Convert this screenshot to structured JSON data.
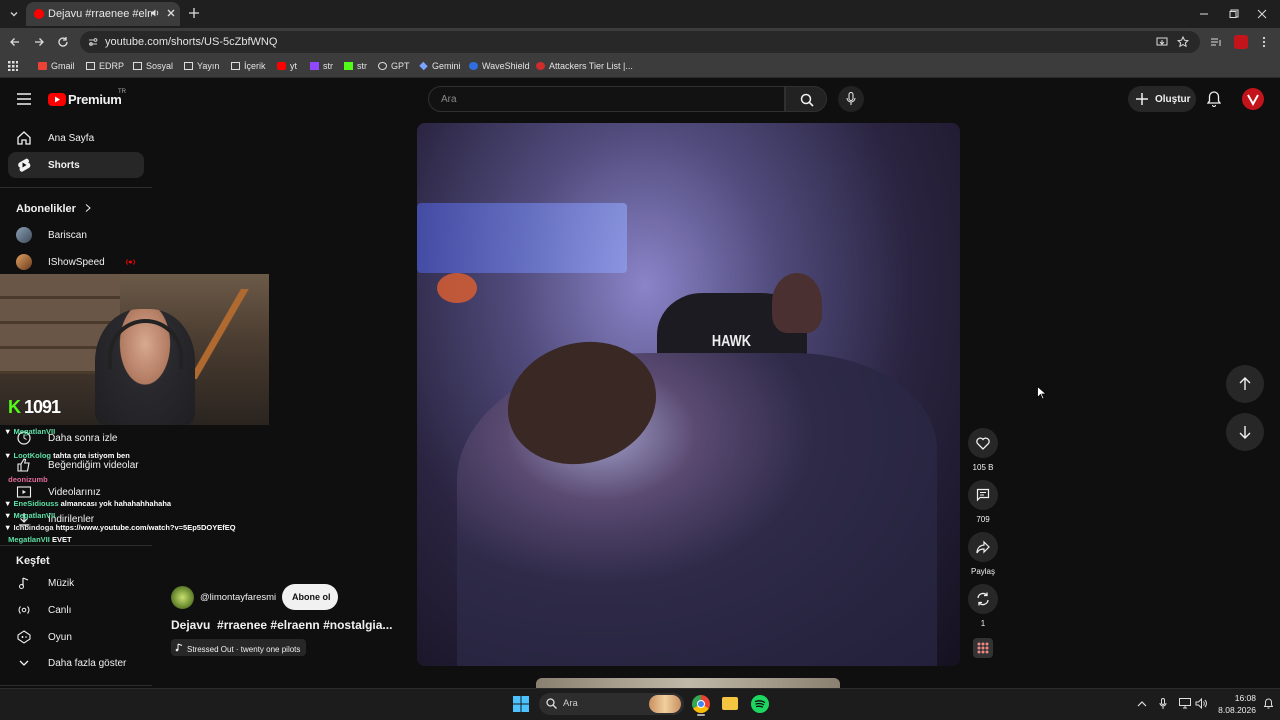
{
  "browser": {
    "tab_title": "Dejavu #rraenee #elraenn #",
    "url": "youtube.com/shorts/US-5cZbfWNQ",
    "bookmarks": [
      "Gmail",
      "EDRP",
      "Sosyal",
      "Yayın",
      "İçerik",
      "yt",
      "str",
      "str",
      "GPT",
      "Gemini",
      "WaveShield",
      "Attackers Tier List |..."
    ]
  },
  "masthead": {
    "logo": "Premium",
    "logo_region": "TR",
    "search_placeholder": "Ara",
    "create_label": "Oluştur"
  },
  "sidebar": {
    "home": "Ana Sayfa",
    "shorts": "Shorts",
    "subscriptions_header": "Abonelikler",
    "subscriptions": [
      "Bariscan",
      "IShowSpeed"
    ],
    "you_items": [
      "Daha sonra izle",
      "Beğendiğim videolar",
      "Videolarınız",
      "İndirilenler"
    ],
    "explore_header": "Keşfet",
    "explore_items": [
      "Müzik",
      "Canlı",
      "Oyun"
    ],
    "show_more": "Daha fazla göster"
  },
  "overlay": {
    "follower_count": "1091",
    "chat": [
      {
        "user": "MegatlanVII",
        "msg": ""
      },
      {
        "user": "LootKolog",
        "msg": "tahta çıta istiyom ben"
      },
      {
        "user": "deonizumb",
        "msg": ""
      },
      {
        "user": "EneSidiouss",
        "msg": "almancası yok hahahahhahaha"
      },
      {
        "user": "MegatlanVII",
        "msg": ""
      },
      {
        "user": "Ichbindoga",
        "msg": "https://www.youtube.com/watch?v=5Ep5DOYEfEQ"
      },
      {
        "user": "MegatlanVII",
        "msg": "EVET"
      }
    ]
  },
  "short": {
    "channel": "@limontayfaresmi",
    "subscribe_label": "Abone ol",
    "title": "Dejavu  #rraenee #elraenn #nostalgia...",
    "sound": "Stressed Out · twenty one pilots",
    "overlay_text": "HAWK",
    "likes": "105 B",
    "comments": "709",
    "share_label": "Paylaş",
    "remix_count": "1"
  },
  "taskbar": {
    "search_placeholder": "Ara",
    "time": "16:08",
    "date": "8.08.2026"
  },
  "colors": {
    "youtube_red": "#ff0000",
    "background": "#0f0f0f",
    "chat_user": "#5ce0a5"
  }
}
